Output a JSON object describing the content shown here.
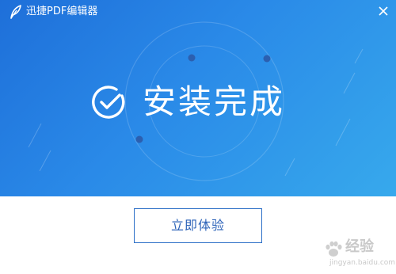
{
  "window": {
    "title": "迅捷PDF编辑器",
    "close_icon": "close-icon",
    "logo_icon": "feather-logo-icon"
  },
  "banner": {
    "status_text": "安装完成",
    "status_icon": "check-circle-icon",
    "colors": {
      "gradient_start": "#1e6fd9",
      "gradient_end": "#37a9ec"
    }
  },
  "actions": {
    "try_now_label": "立即体验",
    "accent_color": "#2c6fc7"
  },
  "watermark": {
    "brand": "经验",
    "url": "jingyan.baidu.com",
    "icon": "paw-icon"
  }
}
